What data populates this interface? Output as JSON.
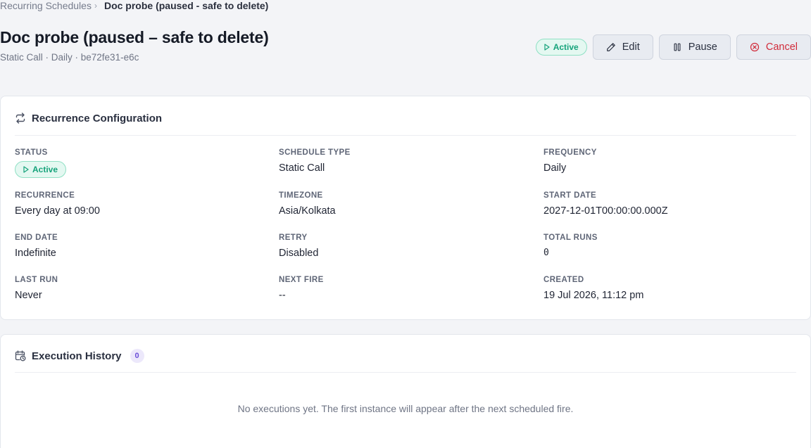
{
  "breadcrumb": {
    "parent": "Recurring Schedules",
    "separator": "›",
    "current": "Doc probe (paused - safe to delete)"
  },
  "page": {
    "title": "Doc probe (paused – safe to delete)",
    "subtitle": "Static Call · Daily · be72fe31-e6c"
  },
  "header": {
    "status_badge": "Active",
    "edit_label": "Edit",
    "pause_label": "Pause",
    "cancel_label": "Cancel"
  },
  "config": {
    "title": "Recurrence Configuration",
    "fields": {
      "status": {
        "label": "Status",
        "value": "Active"
      },
      "schedule_type": {
        "label": "Schedule Type",
        "value": "Static Call"
      },
      "frequency": {
        "label": "Frequency",
        "value": "Daily"
      },
      "recurrence": {
        "label": "Recurrence",
        "value": "Every day at 09:00"
      },
      "timezone": {
        "label": "Timezone",
        "value": "Asia/Kolkata"
      },
      "start_date": {
        "label": "Start Date",
        "value": "2027-12-01T00:00:00.000Z"
      },
      "end_date": {
        "label": "End Date",
        "value": "Indefinite"
      },
      "retry": {
        "label": "Retry",
        "value": "Disabled"
      },
      "total_runs": {
        "label": "Total Runs",
        "value": "0"
      },
      "last_run": {
        "label": "Last Run",
        "value": "Never"
      },
      "next_fire": {
        "label": "Next Fire",
        "value": "--"
      },
      "created": {
        "label": "Created",
        "value": "19 Jul 2026, 11:12 pm"
      }
    }
  },
  "history": {
    "title": "Execution History",
    "count": "0",
    "empty_message": "No executions yet. The first instance will appear after the next scheduled fire."
  },
  "colors": {
    "accent_active": "#16a37b",
    "danger": "#d12b3a",
    "count_badge": "#6b4fd8",
    "background": "#f3f4f7"
  },
  "icons": [
    "chevron-right-icon",
    "play-icon",
    "pencil-icon",
    "pause-icon",
    "x-circle-icon",
    "repeat-icon",
    "calendar-clock-icon"
  ]
}
